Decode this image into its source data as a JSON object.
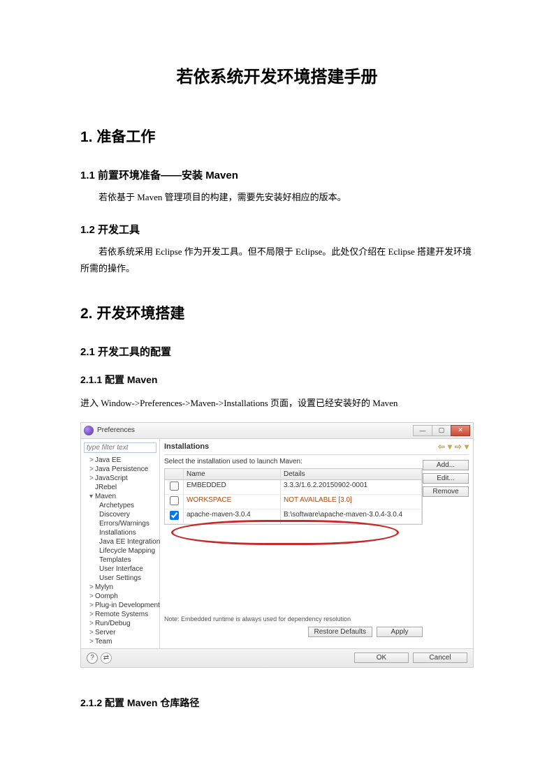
{
  "doc": {
    "title": "若依系统开发环境搭建手册",
    "s1": {
      "h": "1. 准备工作",
      "s11": {
        "h": "1.1 前置环境准备——安装 Maven",
        "p": "若依基于 Maven 管理项目的构建，需要先安装好相应的版本。"
      },
      "s12": {
        "h": "1.2 开发工具",
        "p": "若依系统采用 Eclipse 作为开发工具。但不局限于 Eclipse。此处仅介绍在 Eclipse 搭建开发环境所需的操作。"
      }
    },
    "s2": {
      "h": "2. 开发环境搭建",
      "s21": {
        "h": "2.1 开发工具的配置",
        "s211": {
          "h": "2.1.1 配置 Maven",
          "p": "进入 Window->Preferences->Maven->Installations 页面，设置已经安装好的 Maven"
        },
        "s212": {
          "h": "2.1.2 配置 Maven 仓库路径"
        }
      }
    }
  },
  "dialog": {
    "window_title": "Preferences",
    "filter_placeholder": "type filter text",
    "tree": {
      "items": [
        {
          "expander": ">",
          "label": "Java EE"
        },
        {
          "expander": ">",
          "label": "Java Persistence"
        },
        {
          "expander": ">",
          "label": "JavaScript"
        },
        {
          "expander": "",
          "label": "JRebel"
        },
        {
          "expander": "▾",
          "label": "Maven",
          "children": [
            "Archetypes",
            "Discovery",
            "Errors/Warnings",
            "Installations",
            "Java EE Integration",
            "Lifecycle Mapping",
            "Templates",
            "User Interface",
            "User Settings"
          ]
        },
        {
          "expander": ">",
          "label": "Mylyn"
        },
        {
          "expander": ">",
          "label": "Oomph"
        },
        {
          "expander": ">",
          "label": "Plug-in Development"
        },
        {
          "expander": ">",
          "label": "Remote Systems"
        },
        {
          "expander": ">",
          "label": "Run/Debug"
        },
        {
          "expander": ">",
          "label": "Server"
        },
        {
          "expander": ">",
          "label": "Team"
        }
      ]
    },
    "panel": {
      "title": "Installations",
      "label": "Select the installation used to launch Maven:",
      "columns": {
        "name": "Name",
        "details": "Details"
      },
      "rows": [
        {
          "checked": false,
          "name": "EMBEDDED",
          "details": "3.3.3/1.6.2.20150902-0001"
        },
        {
          "checked": false,
          "name": "WORKSPACE",
          "details": "NOT AVAILABLE [3.0]",
          "orange": true
        },
        {
          "checked": true,
          "name": "apache-maven-3.0.4",
          "details": "B:\\software\\apache-maven-3.0.4-3.0.4"
        }
      ],
      "note": "Note: Embedded runtime is always used for dependency resolution",
      "side_buttons": {
        "add": "Add...",
        "edit": "Edit...",
        "remove": "Remove"
      },
      "bottom_buttons": {
        "restore": "Restore Defaults",
        "apply": "Apply"
      }
    },
    "footer": {
      "ok": "OK",
      "cancel": "Cancel"
    }
  }
}
